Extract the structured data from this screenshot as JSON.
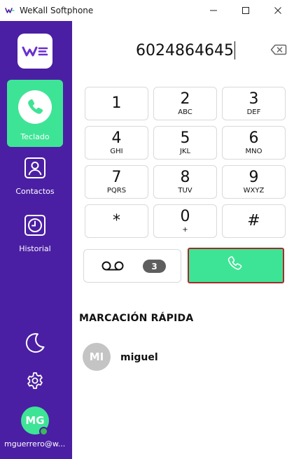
{
  "window": {
    "title": "WeKall Softphone"
  },
  "sidebar": {
    "items": [
      {
        "label": "Teclado",
        "icon": "phone-icon",
        "active": true
      },
      {
        "label": "Contactos",
        "icon": "contact-icon",
        "active": false
      },
      {
        "label": "Historial",
        "icon": "clock-icon",
        "active": false
      }
    ],
    "user": {
      "initials": "MG",
      "email": "mguerrero@w...",
      "status_color": "#3fb65b"
    }
  },
  "dialer": {
    "number": "6024864645",
    "keys": [
      {
        "digit": "1",
        "letters": ""
      },
      {
        "digit": "2",
        "letters": "ABC"
      },
      {
        "digit": "3",
        "letters": "DEF"
      },
      {
        "digit": "4",
        "letters": "GHI"
      },
      {
        "digit": "5",
        "letters": "JKL"
      },
      {
        "digit": "6",
        "letters": "MNO"
      },
      {
        "digit": "7",
        "letters": "PQRS"
      },
      {
        "digit": "8",
        "letters": "TUV"
      },
      {
        "digit": "9",
        "letters": "WXYZ"
      },
      {
        "digit": "*",
        "letters": ""
      },
      {
        "digit": "0",
        "letters": "+"
      },
      {
        "digit": "#",
        "letters": ""
      }
    ],
    "voicemail_count": "3"
  },
  "speed_dial": {
    "title": "MARCACIÓN RÁPIDA",
    "contacts": [
      {
        "initials": "MI",
        "name": "miguel"
      }
    ]
  },
  "colors": {
    "sidebar": "#4b1fa3",
    "accent": "#3ee496"
  }
}
